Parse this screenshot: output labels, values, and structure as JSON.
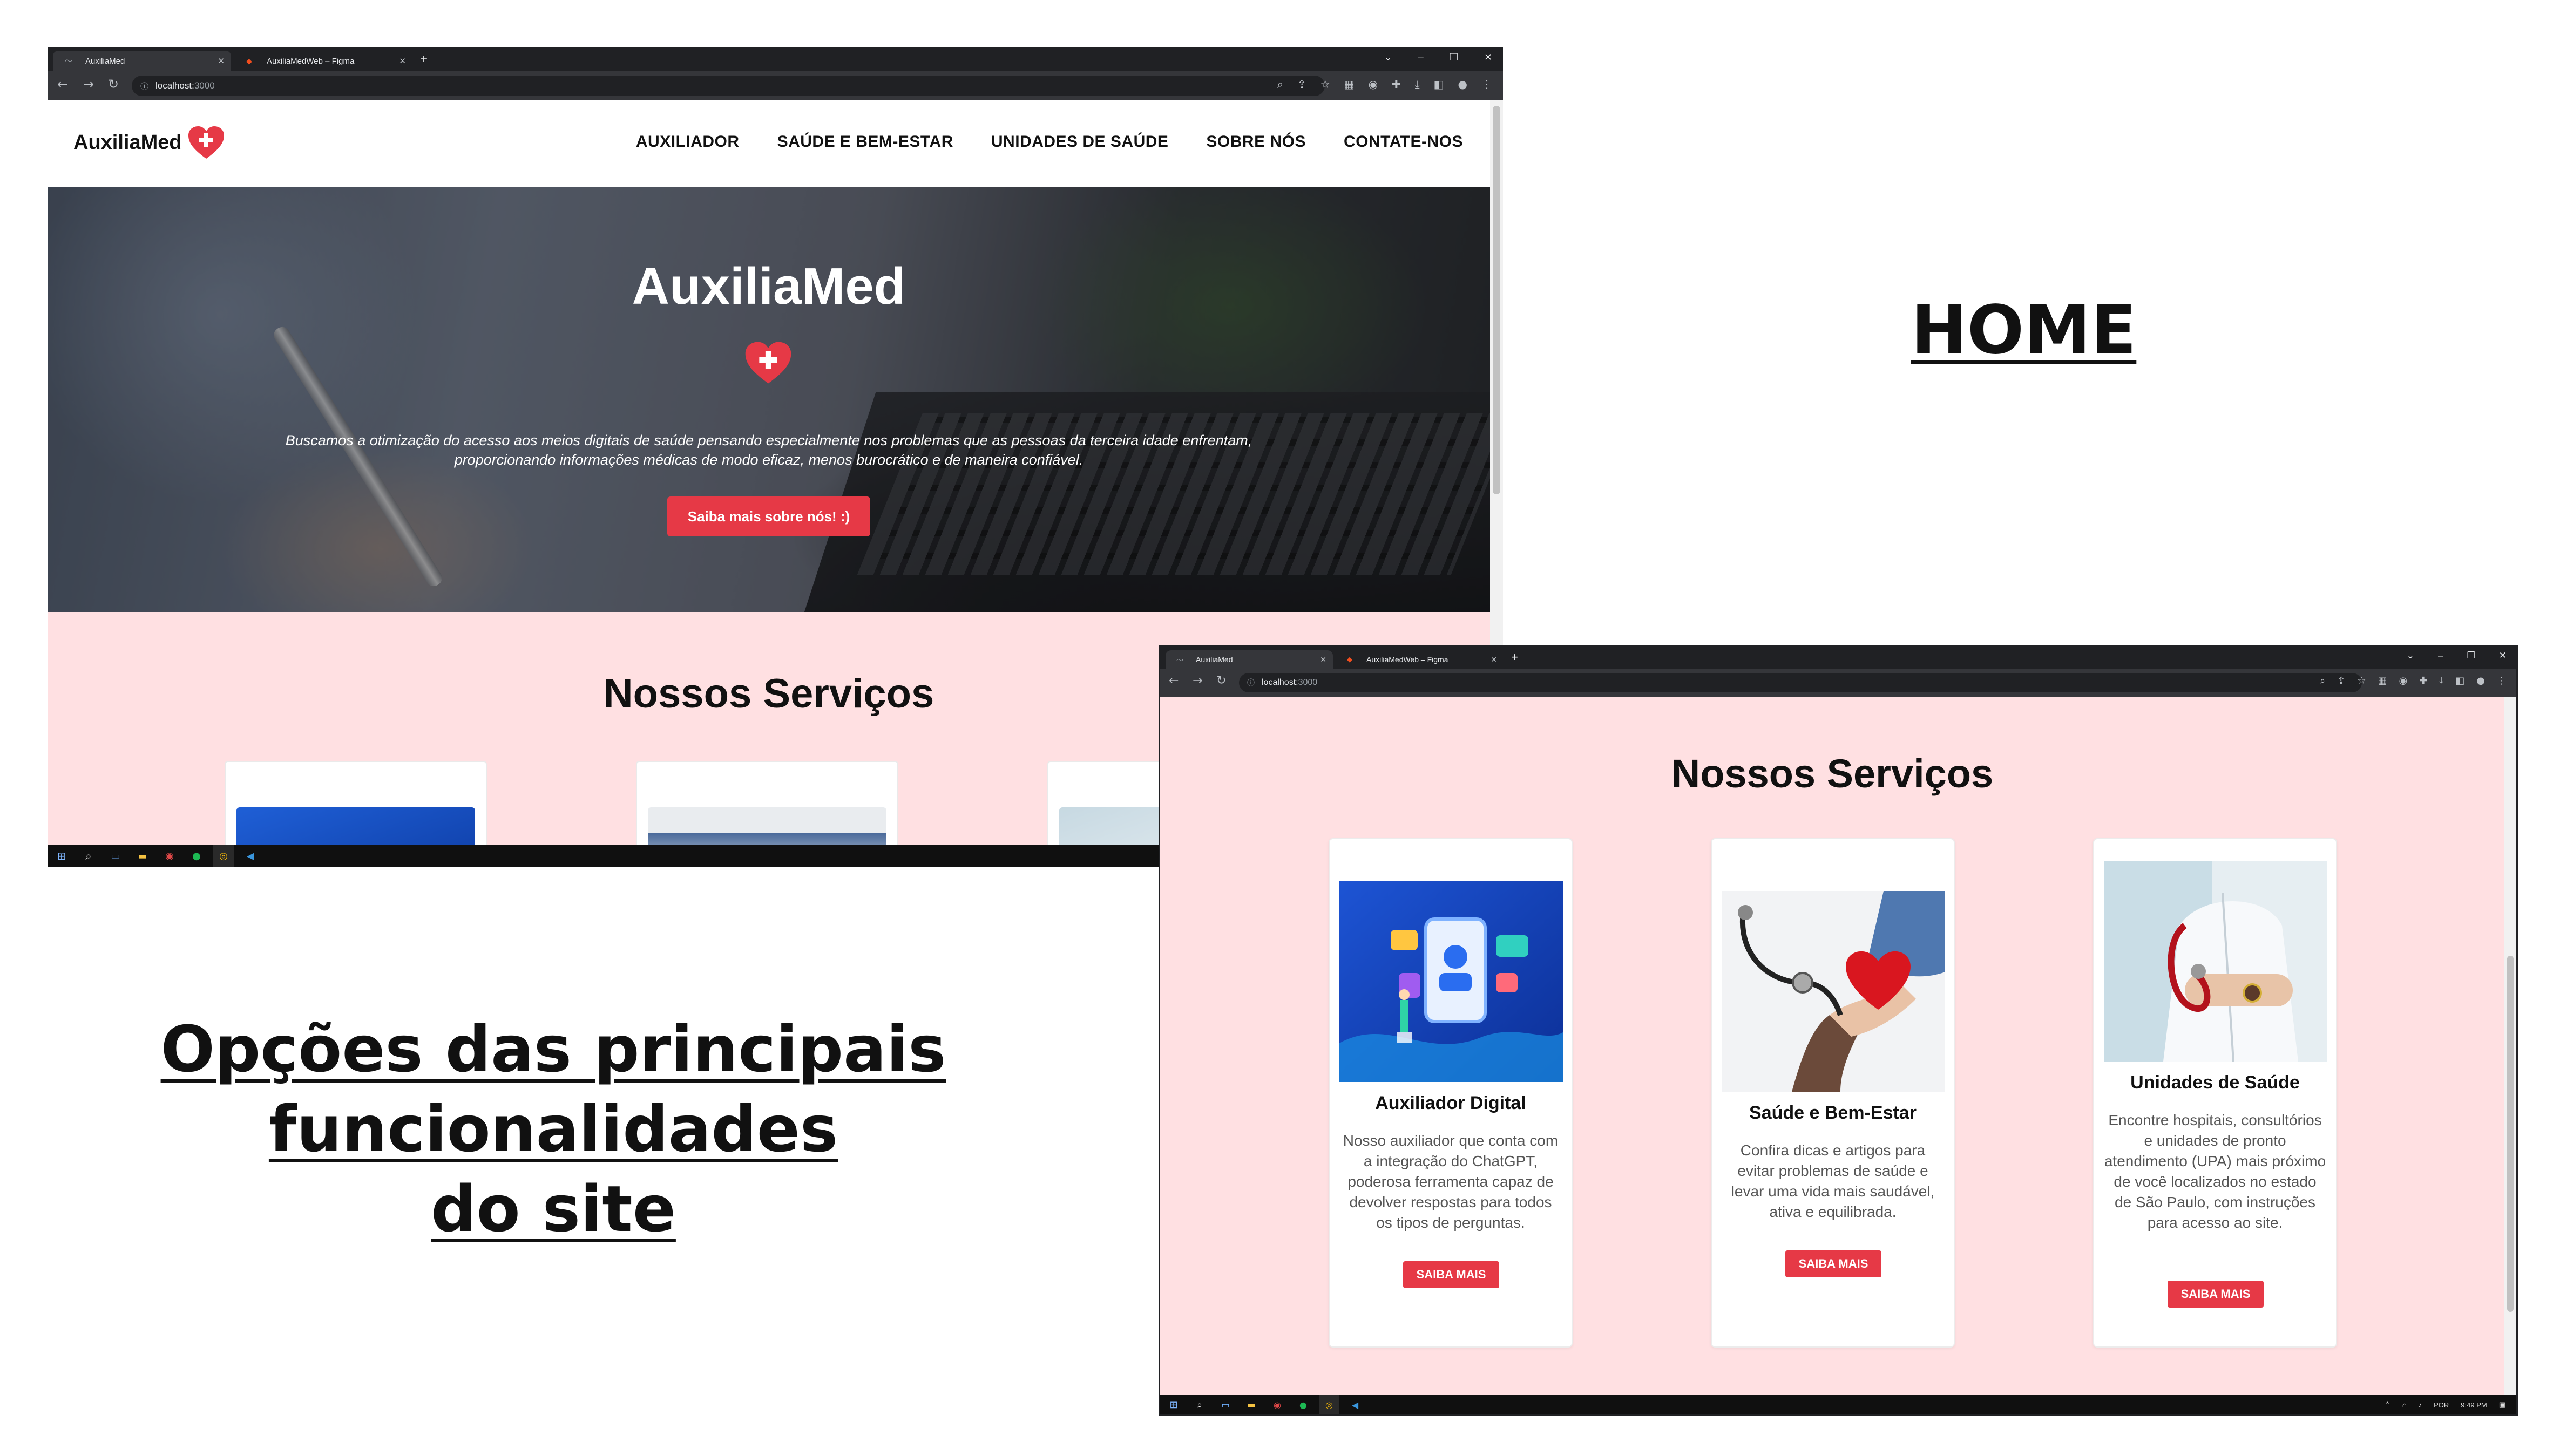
{
  "colors": {
    "accent_red": "#e63946",
    "services_bg": "#ffe0e2",
    "chrome_dark": "#202124",
    "chrome_toolbar": "#35363a"
  },
  "browser": {
    "tabs": [
      {
        "label": "AuxiliaMed",
        "icon": "page-icon",
        "active": true
      },
      {
        "label": "AuxiliaMedWeb – Figma",
        "icon": "figma-icon",
        "active": false
      }
    ],
    "new_tab_label": "+",
    "url_host": "localhost:",
    "url_port": "3000",
    "window_controls": [
      "⌄",
      "–",
      "❐",
      "✕"
    ]
  },
  "site": {
    "brand": "AuxiliaMed",
    "nav": [
      "AUXILIADOR",
      "SAÚDE E BEM-ESTAR",
      "UNIDADES DE SAÚDE",
      "SOBRE NÓS",
      "CONTATE-NOS"
    ],
    "hero": {
      "title": "AuxiliaMed",
      "text_line1": "Buscamos a otimização do acesso aos meios digitais de saúde pensando especialmente nos problemas que as pessoas da terceira idade enfrentam,",
      "text_line2": "proporcionando informações médicas de modo eficaz, menos burocrático e de maneira confiável.",
      "button": "Saiba mais sobre nós! :)"
    },
    "services_title": "Nossos Serviços",
    "cards": [
      {
        "title": "Auxiliador Digital",
        "description": "Nosso auxiliador que conta com a integração do ChatGPT, poderosa ferramenta capaz de devolver respostas para todos os tipos de perguntas.",
        "button": "SAIBA MAIS"
      },
      {
        "title": "Saúde e Bem-Estar",
        "description": "Confira dicas e artigos para evitar problemas de saúde e levar uma vida mais saudável, ativa e equilibrada.",
        "button": "SAIBA MAIS"
      },
      {
        "title": "Unidades de Saúde",
        "description": "Encontre hospitais, consultórios e unidades de pronto atendimento (UPA) mais próximo de você localizados no estado de São Paulo, com instruções para acesso ao site.",
        "button": "SAIBA MAIS"
      }
    ]
  },
  "taskbar": {
    "icons": [
      "windows-start-icon",
      "search-icon",
      "task-view-icon",
      "file-explorer-icon",
      "record-icon",
      "spotify-icon",
      "chrome-icon",
      "vscode-icon"
    ],
    "lang": "POR",
    "time": "9:49 PM"
  },
  "captions": {
    "home": "HOME",
    "options_line1": "Opções das principais",
    "options_line2": "funcionalidades",
    "options_line3": "do site"
  }
}
